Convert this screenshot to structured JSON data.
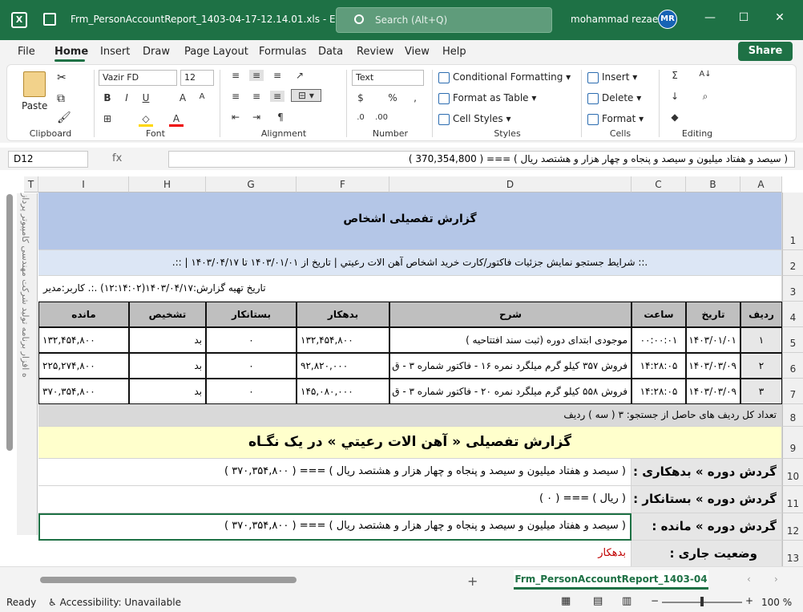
{
  "titlebar": {
    "app_logo": "X",
    "filename": "Frm_PersonAccountReport_1403-04-17-12.14.01.xls",
    "app_name": "Excel",
    "search_placeholder": "Search (Alt+Q)",
    "user": "mohammad rezaei",
    "initials": "MR",
    "minimize": "—",
    "maximize": "☐",
    "close": "✕"
  },
  "menu": [
    "File",
    "Home",
    "Insert",
    "Draw",
    "Page Layout",
    "Formulas",
    "Data",
    "Review",
    "View",
    "Help"
  ],
  "share": "Share",
  "ribbon": {
    "clipboard": {
      "label": "Clipboard",
      "paste": "Paste"
    },
    "font": {
      "label": "Font",
      "name": "Vazir FD",
      "size": "12"
    },
    "alignment": {
      "label": "Alignment"
    },
    "number": {
      "label": "Number",
      "format": "Text"
    },
    "styles": {
      "label": "Styles",
      "conditional": "Conditional Formatting",
      "table": "Format as Table",
      "cell": "Cell Styles"
    },
    "cells": {
      "label": "Cells",
      "insert": "Insert",
      "delete": "Delete",
      "format": "Format"
    },
    "editing": {
      "label": "Editing"
    }
  },
  "formula_bar": {
    "namebox": "D12",
    "fx": "fx",
    "content": "( سیصد و هفتاد  میلیون و سیصد و پنجاه و چهار هزار و هشتصد ریال ) === ( 370,354,800 )"
  },
  "columns": [
    "T",
    "I",
    "H",
    "G",
    "F",
    "D",
    "C",
    "B",
    "A"
  ],
  "rows": [
    "1",
    "2",
    "3",
    "4",
    "5",
    "6",
    "7",
    "8",
    "9",
    "10",
    "11",
    "12",
    "13"
  ],
  "sheet": {
    "title": "گزارش تفصیلی اشخاص",
    "conditions": ".:: شرایط جستجو  نمایش جزئیات فاکتور/کارت خرید اشخاص  آهن الات رعيتي  | تاریخ از ۱۴۰۳/۰۱/۰۱ تا ۱۴۰۳/۰۴/۱۷  |  ::.",
    "prepared": "تاریخ تهیه گزارش:۱۴۰۳/۰۴/۱۷(۱۲:۱۴:۰۲) .:. کاربر:مدیر",
    "headers": [
      "ردیف",
      "تاریخ",
      "ساعت",
      "شرح",
      "بدهکار",
      "بستانکار",
      "تشخیص",
      "مانده"
    ],
    "data_rows": [
      [
        "۱",
        "۱۴۰۳/۰۱/۰۱",
        "۰۰:۰۰:۰۱",
        "موجودی ابتدای دوره (ثبت سند افتتاحیه )",
        "۱۳۲,۴۵۴,۸۰۰",
        "۰",
        "بد",
        "۱۳۲,۴۵۴,۸۰۰"
      ],
      [
        "۲",
        "۱۴۰۳/۰۳/۰۹",
        "۱۴:۲۸:۰۵",
        "فروش ۳۵۷ کیلو گرم میلگرد نمره ۱۶ -  فاکتور شماره ۳ - ق",
        "۹۲,۸۲۰,۰۰۰",
        "۰",
        "بد",
        "۲۲۵,۲۷۴,۸۰۰"
      ],
      [
        "۳",
        "۱۴۰۳/۰۳/۰۹",
        "۱۴:۲۸:۰۵",
        "فروش ۵۵۸ کیلو گرم میلگرد نمره ۲۰ -  فاکتور شماره ۳ - ق",
        "۱۴۵,۰۸۰,۰۰۰",
        "۰",
        "بد",
        "۳۷۰,۳۵۴,۸۰۰"
      ]
    ],
    "count": "تعداد کل ردیف های حاصل از جستجو: ۳ ( سه  ) ردیف",
    "summary_title": "گزارش تفصیلی « آهن الات رعيتي » در یک نگـاه",
    "debit_label": "گردش دوره » بدهکاری :",
    "debit_value": "( سیصد و هفتاد  میلیون و سیصد و پنجاه و چهار هزار و هشتصد ریال ) === ( ۳۷۰,۳۵۴,۸۰۰ )",
    "credit_label": "گردش دوره » بستانکار :",
    "credit_value": "( ریال  ) === ( ۰ )",
    "balance_label": "گردش دوره » مانده :",
    "balance_value": "( سیصد و هفتاد  میلیون و سیصد و پنجاه و چهار هزار و هشتصد ریال ) === ( ۳۷۰,۳۵۴,۸۰۰ )",
    "status_label": "وضعیت جاری :",
    "status_value": "بدهکار",
    "side_text": "ه افزار برنامه تولید شرکت مهندسی کامپیوتر پرداز"
  },
  "sheet_tab": "Frm_PersonAccountReport_1403-04",
  "status": {
    "ready": "Ready",
    "accessibility": "Accessibility: Unavailable",
    "zoom": "100 %"
  },
  "colors": {
    "header_bg": "#b4c6e7",
    "summary_bg": "#ffffcc",
    "table_header_bg": "#bfbfbf",
    "accent": "#1e7145",
    "status_red": "#c00000"
  }
}
